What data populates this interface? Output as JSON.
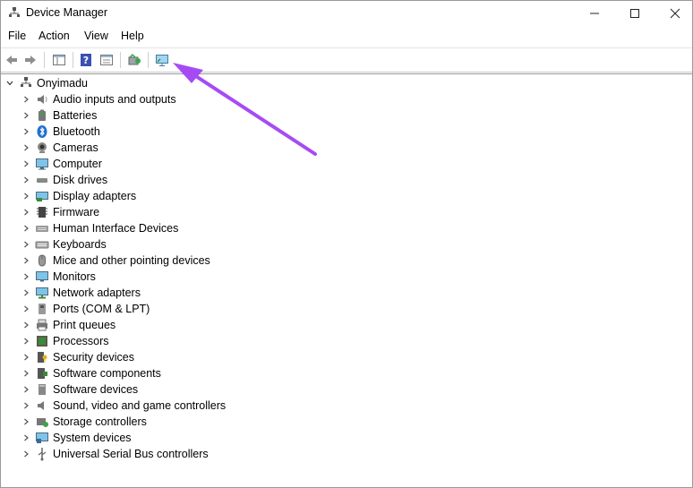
{
  "window": {
    "title": "Device Manager"
  },
  "menu": [
    "File",
    "Action",
    "View",
    "Help"
  ],
  "toolbar": [
    "back-icon",
    "forward-icon",
    "console-tree-icon",
    "help-icon",
    "properties-icon",
    "scan-hardware-icon",
    "monitor-icon"
  ],
  "tree": {
    "root": "Onyimadu",
    "items": [
      {
        "label": "Audio inputs and outputs",
        "icon": "speaker-icon"
      },
      {
        "label": "Batteries",
        "icon": "battery-icon"
      },
      {
        "label": "Bluetooth",
        "icon": "bluetooth-icon"
      },
      {
        "label": "Cameras",
        "icon": "camera-icon"
      },
      {
        "label": "Computer",
        "icon": "computer-icon"
      },
      {
        "label": "Disk drives",
        "icon": "disk-drive-icon"
      },
      {
        "label": "Display adapters",
        "icon": "display-adapter-icon"
      },
      {
        "label": "Firmware",
        "icon": "firmware-icon"
      },
      {
        "label": "Human Interface Devices",
        "icon": "hid-icon"
      },
      {
        "label": "Keyboards",
        "icon": "keyboard-icon"
      },
      {
        "label": "Mice and other pointing devices",
        "icon": "mouse-icon"
      },
      {
        "label": "Monitors",
        "icon": "monitor-icon"
      },
      {
        "label": "Network adapters",
        "icon": "network-adapter-icon"
      },
      {
        "label": "Ports (COM & LPT)",
        "icon": "port-icon"
      },
      {
        "label": "Print queues",
        "icon": "printer-icon"
      },
      {
        "label": "Processors",
        "icon": "processor-icon"
      },
      {
        "label": "Security devices",
        "icon": "security-device-icon"
      },
      {
        "label": "Software components",
        "icon": "software-component-icon"
      },
      {
        "label": "Software devices",
        "icon": "software-device-icon"
      },
      {
        "label": "Sound, video and game controllers",
        "icon": "sound-icon"
      },
      {
        "label": "Storage controllers",
        "icon": "storage-controller-icon"
      },
      {
        "label": "System devices",
        "icon": "system-device-icon"
      },
      {
        "label": "Universal Serial Bus controllers",
        "icon": "usb-icon"
      }
    ]
  },
  "annotation": {
    "color": "#a64bf4",
    "icon": "annotation-arrow"
  }
}
